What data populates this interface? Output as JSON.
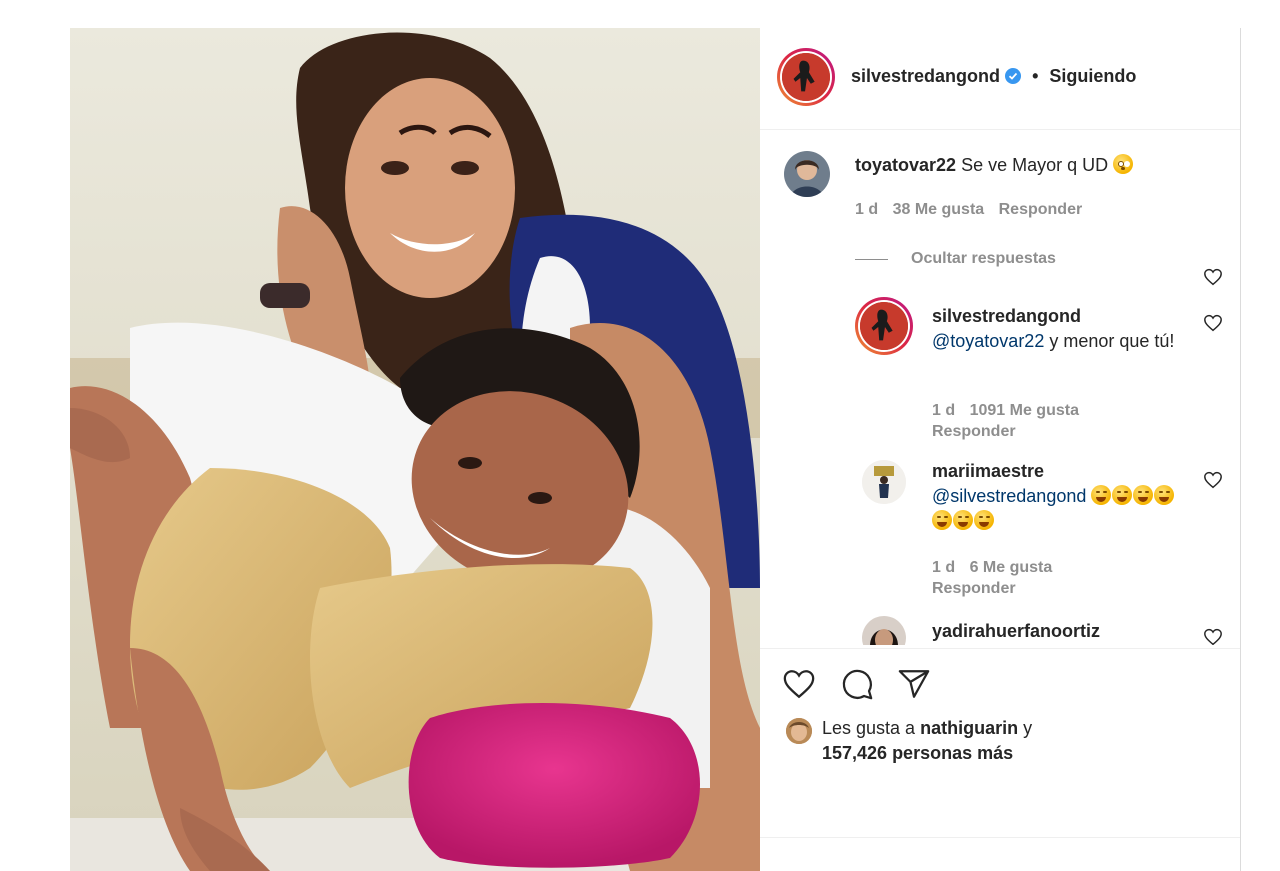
{
  "post": {
    "author": "silvestredangond",
    "follow_separator": "•",
    "follow_status": "Siguiendo"
  },
  "comments": [
    {
      "username": "toyatovar22",
      "text": "Se ve Mayor q UD",
      "emoji": "flushed-face",
      "time": "1 d",
      "likes": "38 Me gusta",
      "reply": "Responder"
    }
  ],
  "hide_replies": "Ocultar respuestas",
  "replies": [
    {
      "username": "silvestredangond",
      "mention": "@toyatovar22",
      "text": "y menor que tú!",
      "time": "1 d",
      "likes": "1091 Me gusta",
      "reply": "Responder"
    },
    {
      "username": "mariimaestre",
      "mention": "@silvestredangond",
      "emoji": "face-with-tears-of-joy",
      "emoji_count": 7,
      "time": "1 d",
      "likes": "6 Me gusta",
      "reply": "Responder"
    },
    {
      "username": "yadirahuerfanoortiz"
    }
  ],
  "actions": {
    "like_icon": "heart-icon",
    "comment_icon": "comment-bubble-icon",
    "share_icon": "paper-plane-icon"
  },
  "likes_summary": {
    "prefix": "Les gusta a",
    "user": "nathiguarin",
    "conjunction": "y",
    "others": "157,426 personas más"
  },
  "colors": {
    "text": "#262626",
    "secondary": "#8e8e8e",
    "mention": "#00376b",
    "verified": "#3897f0",
    "divider": "#efefef"
  }
}
